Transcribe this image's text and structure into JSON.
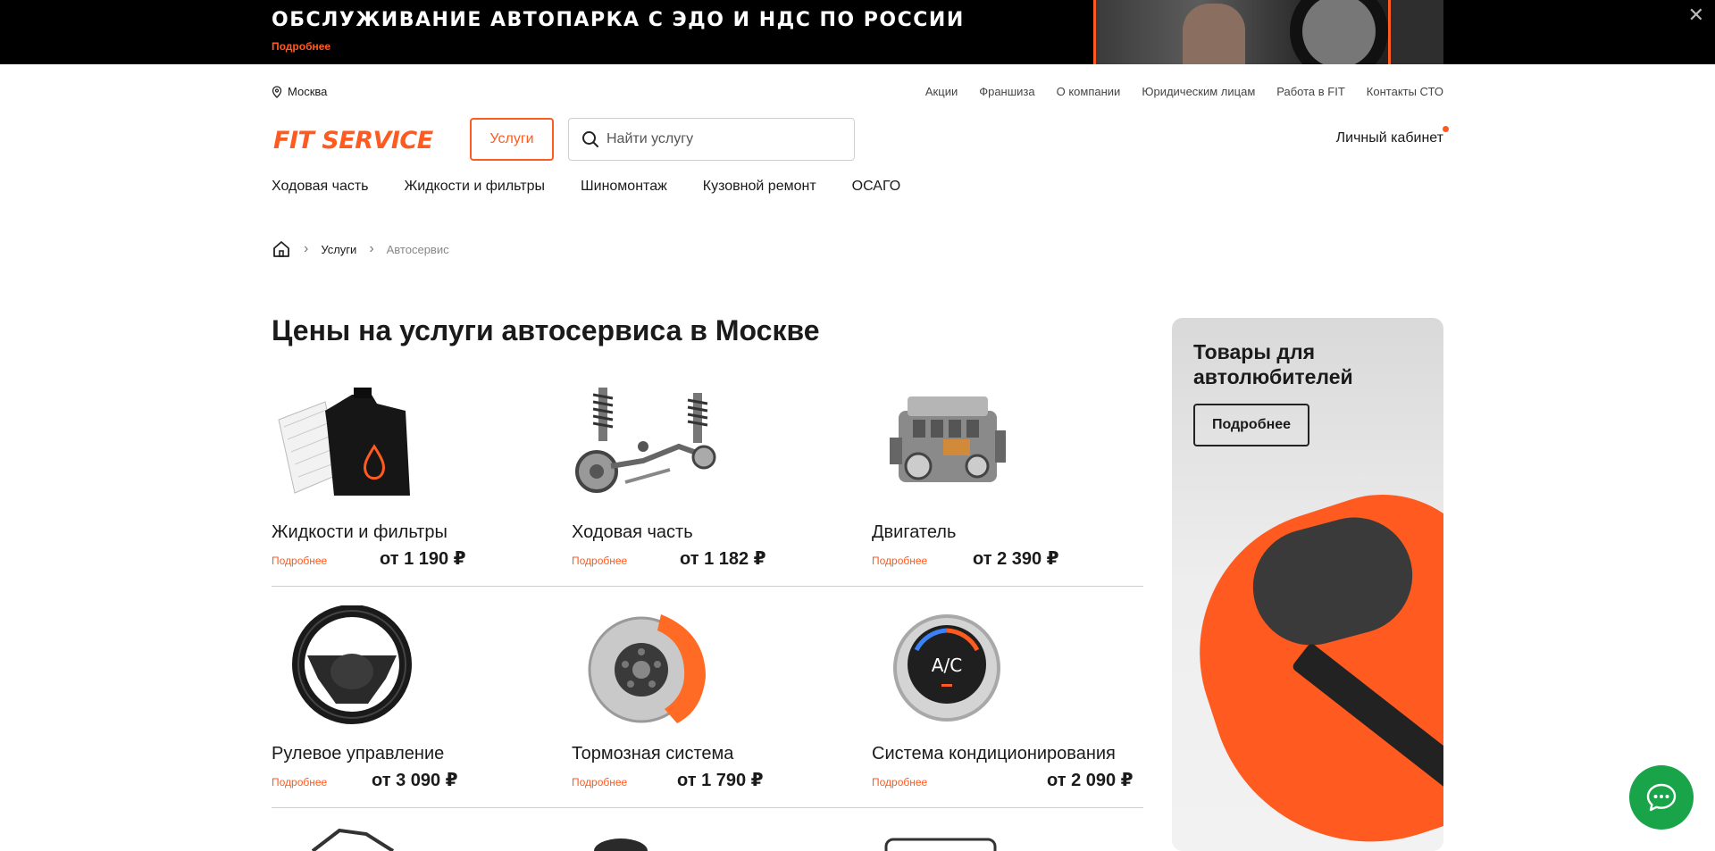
{
  "banner": {
    "title": "ОБСЛУЖИВАНИЕ АВТОПАРКА С ЭДО И НДС ПО РОССИИ",
    "more": "Подробнее",
    "close": "✕"
  },
  "header": {
    "city": "Москва",
    "links": [
      "Акции",
      "Франшиза",
      "О компании",
      "Юридическим лицам",
      "Работа в FIT",
      "Контакты СТО"
    ],
    "logo": "FIT SERVICE",
    "services_button": "Услуги",
    "search_placeholder": "Найти услугу",
    "cabinet": "Личный кабинет"
  },
  "catnav": [
    "Ходовая часть",
    "Жидкости и фильтры",
    "Шиномонтаж",
    "Кузовной ремонт",
    "ОСАГО"
  ],
  "breadcrumb": {
    "items": [
      "Услуги"
    ],
    "current": "Автосервис"
  },
  "page_title": "Цены на услуги автосервиса в Москве",
  "services": [
    {
      "name": "Жидкости и фильтры",
      "more": "Подробнее",
      "price": "от 1 190 ₽",
      "icon": "oil-canister-icon"
    },
    {
      "name": "Ходовая часть",
      "more": "Подробнее",
      "price": "от 1 182 ₽",
      "icon": "suspension-icon"
    },
    {
      "name": "Двигатель",
      "more": "Подробнее",
      "price": "от 2 390 ₽",
      "icon": "engine-icon"
    },
    {
      "name": "Рулевое управление",
      "more": "Подробнее",
      "price": "от 3 090 ₽",
      "icon": "steering-wheel-icon"
    },
    {
      "name": "Тормозная система",
      "more": "Подробнее",
      "price": "от 1 790 ₽",
      "icon": "brake-disc-icon"
    },
    {
      "name": "Система кондиционирования",
      "more": "Подробнее",
      "price": "от 2 090 ₽",
      "icon": "ac-gauge-icon"
    }
  ],
  "ac_gauge_text": "A/C",
  "promo": {
    "title": "Товары для автолюбителей",
    "button": "Подробнее"
  },
  "colors": {
    "accent": "#ff5a1f",
    "chat": "#19a44a",
    "text": "#1a1a1a"
  }
}
